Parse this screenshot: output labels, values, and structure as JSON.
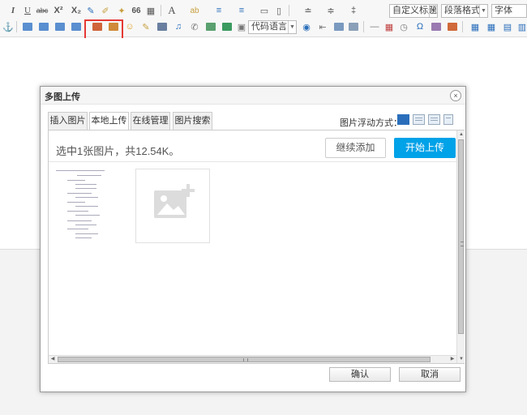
{
  "toolbar": {
    "row1_icons": [
      {
        "name": "italic-icon",
        "glyph": "I"
      },
      {
        "name": "underline-icon",
        "glyph": "U"
      },
      {
        "name": "strikethrough-icon",
        "glyph": "abc"
      },
      {
        "name": "superscript-icon",
        "glyph": "X²"
      },
      {
        "name": "subscript-icon",
        "glyph": "X₂"
      },
      {
        "name": "eraser-icon",
        "glyph": "✎"
      },
      {
        "name": "format-painter-icon",
        "glyph": "✐"
      },
      {
        "name": "autotypeset-icon",
        "glyph": "✦"
      },
      {
        "name": "blockquote-icon",
        "glyph": "66"
      },
      {
        "name": "paste-plain-icon",
        "glyph": "▦"
      },
      {
        "name": "font-color-icon",
        "glyph": "A"
      },
      {
        "name": "highlight-color-icon",
        "glyph": "ab"
      },
      {
        "name": "ordered-list-icon",
        "glyph": "≡"
      },
      {
        "name": "unordered-list-icon",
        "glyph": "≡"
      },
      {
        "name": "select-all-icon",
        "glyph": "▭"
      },
      {
        "name": "clear-doc-icon",
        "glyph": "▯"
      },
      {
        "name": "row-spacing-top-icon",
        "glyph": "≐"
      },
      {
        "name": "row-spacing-bottom-icon",
        "glyph": "≑"
      },
      {
        "name": "line-height-icon",
        "glyph": "‡"
      }
    ],
    "custom_title_select": "自定义标题",
    "paragraph_format_select": "段落格式",
    "font_family_select": "字体",
    "code_language_select": "代码语言"
  },
  "dialog": {
    "title": "多图上传",
    "close_glyph": "×",
    "tabs": [
      {
        "label": "插入图片"
      },
      {
        "label": "本地上传"
      },
      {
        "label": "在线管理"
      },
      {
        "label": "图片搜索"
      }
    ],
    "float_label": "图片浮动方式：",
    "status_text": "选中1张图片，共12.54K。",
    "continue_button": "继续添加",
    "start_button": "开始上传",
    "ok_button": "确认",
    "cancel_button": "取消",
    "vscroll_up": "▲",
    "vscroll_down": "▼",
    "hscroll_left": "◀",
    "hscroll_right": "▶"
  },
  "colors": {
    "accent": "#00a2e8",
    "highlight_box": "#e53935"
  }
}
